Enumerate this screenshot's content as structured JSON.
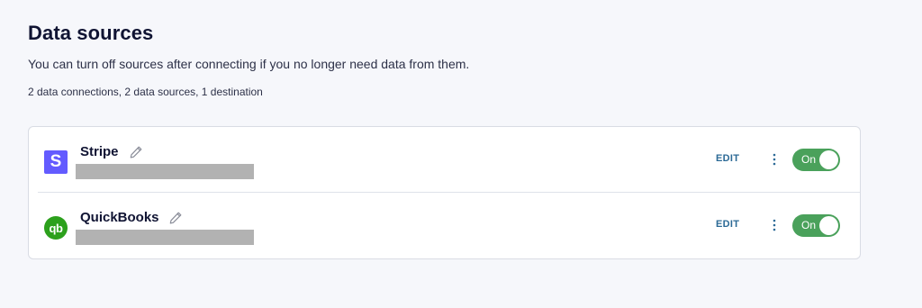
{
  "header": {
    "title": "Data sources",
    "subtitle": "You can turn off sources after connecting if you no longer need data from them.",
    "summary": "2 data connections, 2 data sources, 1 destination"
  },
  "sources": [
    {
      "name": "Stripe",
      "logo_icon": "stripe-logo-icon",
      "logo_text": "S",
      "logo_color": "#635bff",
      "edit_label": "EDIT",
      "toggle_label": "On",
      "enabled": true
    },
    {
      "name": "QuickBooks",
      "logo_icon": "quickbooks-logo-icon",
      "logo_text": "qb",
      "logo_color": "#2ca01c",
      "edit_label": "EDIT",
      "toggle_label": "On",
      "enabled": true
    }
  ],
  "colors": {
    "accent_link": "#2c6a96",
    "toggle_on": "#4aa15b",
    "background": "#f6f7fb"
  }
}
